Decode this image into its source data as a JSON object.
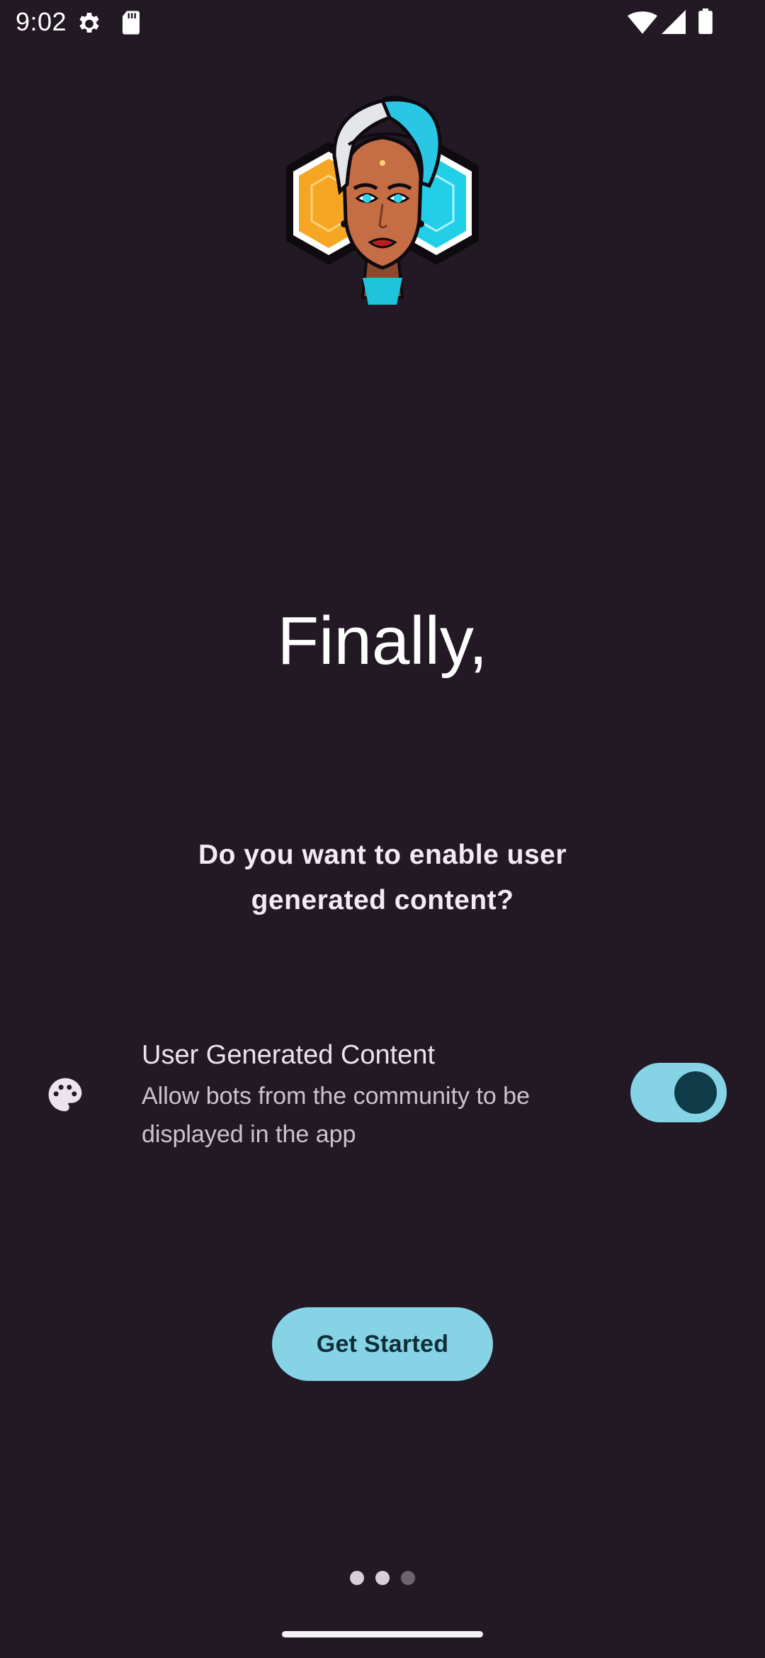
{
  "status_bar": {
    "time": "9:02",
    "icons": [
      "gear-icon",
      "sd-card-icon",
      "wifi-icon",
      "signal-icon",
      "battery-icon"
    ]
  },
  "logo": {
    "icon": "avatar-logo",
    "colors": {
      "left_hex": "#f6a623",
      "right_hex": "#22d3ee",
      "hair": "#d9dde3"
    }
  },
  "headline": "Finally,",
  "question": "Do you want to enable user generated content?",
  "setting": {
    "icon": "palette-icon",
    "title": "User Generated Content",
    "description": "Allow bots from the community to be displayed in the app",
    "enabled": true
  },
  "button": {
    "label": "Get Started"
  },
  "pager": {
    "total": 3,
    "active": [
      1,
      2
    ]
  },
  "colors": {
    "background": "#231925",
    "accent": "#86d3e6",
    "accent_dark": "#0e3b47"
  }
}
